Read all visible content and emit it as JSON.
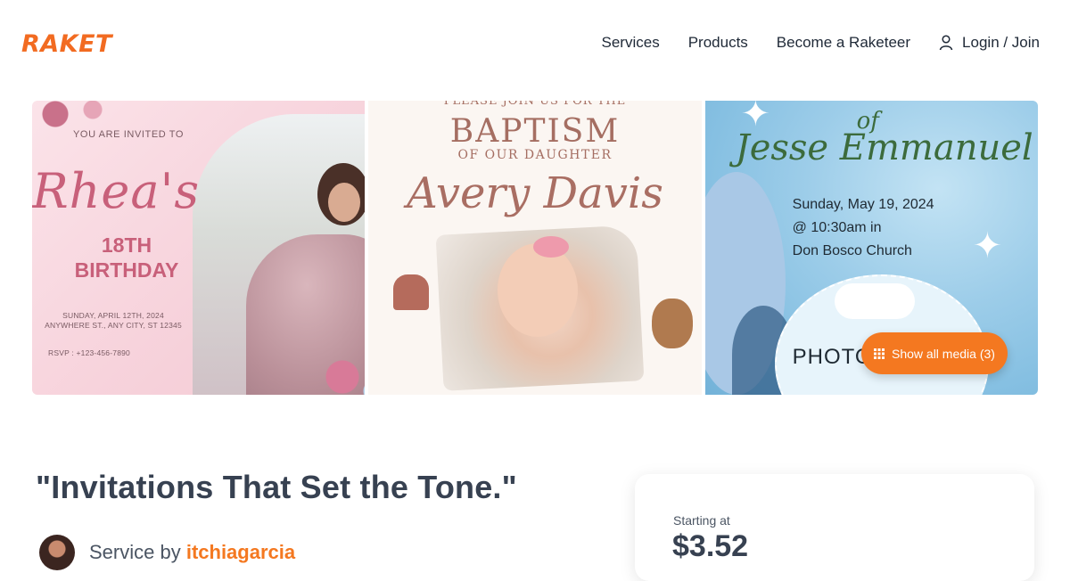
{
  "header": {
    "logo": "RAKET",
    "nav": {
      "services": "Services",
      "products": "Products",
      "become": "Become a Raketeer",
      "login": "Login / Join"
    }
  },
  "gallery": {
    "panel1": {
      "invited": "YOU ARE INVITED TO",
      "name": "Rhea's",
      "occasion_line1": "18TH",
      "occasion_line2": "BIRTHDAY",
      "details_line1": "SUNDAY, APRIL 12TH, 2024",
      "details_line2": "ANYWHERE ST., ANY CITY, ST 12345",
      "rsvp": "RSVP : +123-456-7890"
    },
    "panel2": {
      "please_join": "PLEASE JOIN US FOR THE",
      "baptism": "BAPTISM",
      "daughter": "OF OUR DAUGHTER",
      "name": "Avery Davis"
    },
    "panel3": {
      "of": "of",
      "name": "Jesse Emmanuel",
      "date": "Sunday, May 19, 2024",
      "time": "@ 10:30am in",
      "venue": "Don Bosco Church",
      "photo": "PHOTO"
    },
    "show_media_label": "Show all media (3)"
  },
  "listing": {
    "title": "\"Invitations That Set the Tone.\"",
    "service_by_prefix": "Service by ",
    "seller": "itchiagarcia"
  },
  "pricing": {
    "starting_at": "Starting at",
    "price": "$3.52"
  },
  "colors": {
    "brand": "#f26b21",
    "button": "#f47820",
    "heading": "#374151"
  }
}
